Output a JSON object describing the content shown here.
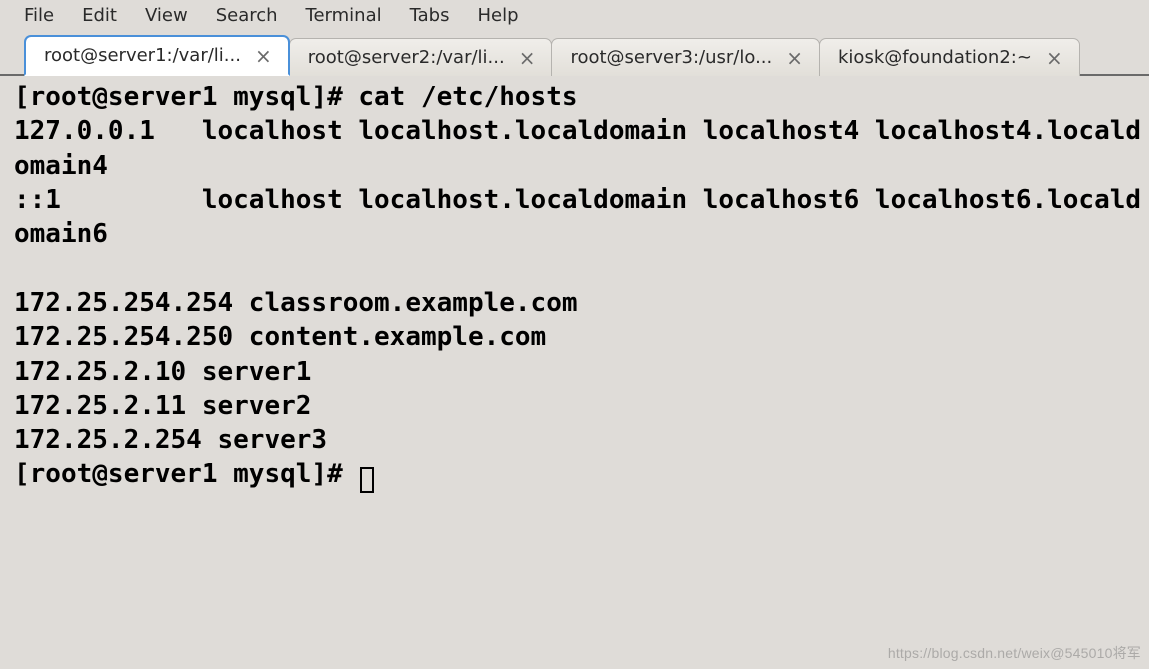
{
  "menubar": {
    "items": [
      "File",
      "Edit",
      "View",
      "Search",
      "Terminal",
      "Tabs",
      "Help"
    ]
  },
  "tabs": [
    {
      "label": "root@server1:/var/li...",
      "active": true
    },
    {
      "label": "root@server2:/var/li...",
      "active": false
    },
    {
      "label": "root@server3:/usr/lo...",
      "active": false
    },
    {
      "label": "kiosk@foundation2:~",
      "active": false
    }
  ],
  "terminal": {
    "prompt1": "[root@server1 mysql]# ",
    "command1": "cat /etc/hosts",
    "output_lines": [
      "127.0.0.1   localhost localhost.localdomain localhost4 localhost4.localdomain4",
      "::1         localhost localhost.localdomain localhost6 localhost6.localdomain6",
      "",
      "172.25.254.254 classroom.example.com",
      "172.25.254.250 content.example.com",
      "172.25.2.10 server1",
      "172.25.2.11 server2",
      "172.25.2.254 server3"
    ],
    "prompt2": "[root@server1 mysql]# "
  },
  "watermark": "https://blog.csdn.net/weix@545010将军",
  "close_glyph": "×"
}
